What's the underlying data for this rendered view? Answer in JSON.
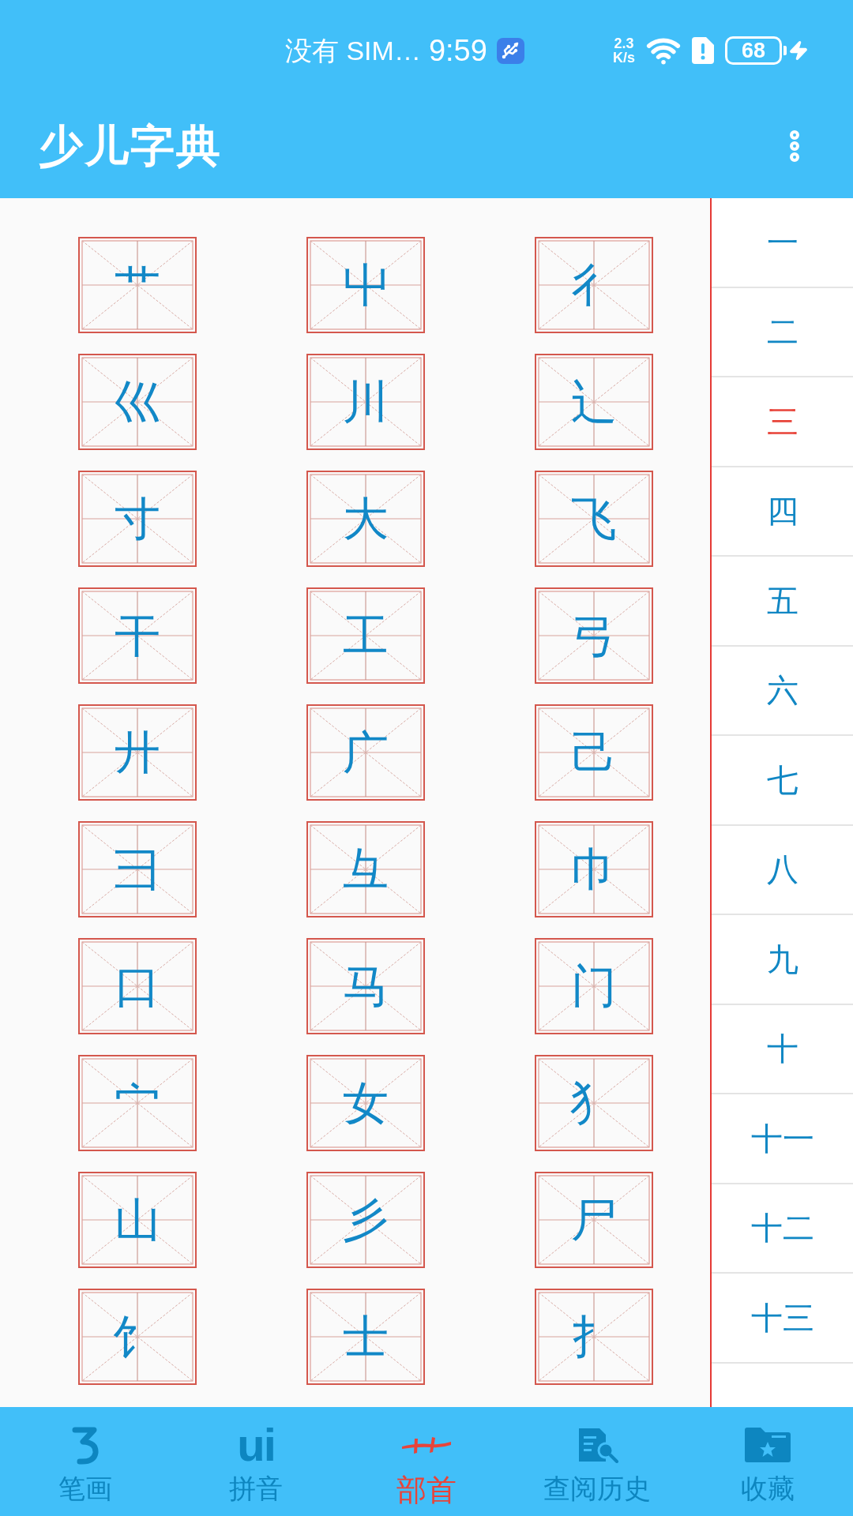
{
  "status_bar": {
    "carrier": "没有 SIM…",
    "time": "9:59",
    "speed_value": "2.3",
    "speed_unit": "K/s",
    "battery": "68",
    "charging": true
  },
  "app_bar": {
    "title": "少儿字典"
  },
  "radicals": [
    {
      "char": "艹"
    },
    {
      "char": "屮"
    },
    {
      "char": "彳"
    },
    {
      "char": "巛"
    },
    {
      "char": "川"
    },
    {
      "char": "辶"
    },
    {
      "char": "寸"
    },
    {
      "char": "大"
    },
    {
      "char": "飞"
    },
    {
      "char": "干"
    },
    {
      "char": "工"
    },
    {
      "char": "弓"
    },
    {
      "char": "廾"
    },
    {
      "char": "广"
    },
    {
      "char": "己"
    },
    {
      "char": "彐"
    },
    {
      "char": "彑"
    },
    {
      "char": "巾"
    },
    {
      "char": "口"
    },
    {
      "char": "马"
    },
    {
      "char": "门"
    },
    {
      "char": "宀"
    },
    {
      "char": "女"
    },
    {
      "char": "犭"
    },
    {
      "char": "山"
    },
    {
      "char": "彡"
    },
    {
      "char": "尸"
    },
    {
      "char": "饣"
    },
    {
      "char": "士"
    },
    {
      "char": "扌"
    }
  ],
  "stroke_counts": [
    {
      "label": "一",
      "selected": false
    },
    {
      "label": "二",
      "selected": false
    },
    {
      "label": "三",
      "selected": true
    },
    {
      "label": "四",
      "selected": false
    },
    {
      "label": "五",
      "selected": false
    },
    {
      "label": "六",
      "selected": false
    },
    {
      "label": "七",
      "selected": false
    },
    {
      "label": "八",
      "selected": false
    },
    {
      "label": "九",
      "selected": false
    },
    {
      "label": "十",
      "selected": false
    },
    {
      "label": "十一",
      "selected": false
    },
    {
      "label": "十二",
      "selected": false
    },
    {
      "label": "十三",
      "selected": false
    }
  ],
  "bottom_nav": [
    {
      "label": "笔画",
      "kind": "stroke",
      "selected": false
    },
    {
      "label": "拼音",
      "kind": "pinyin",
      "glyph": "ui",
      "selected": false
    },
    {
      "label": "部首",
      "kind": "radical",
      "selected": true
    },
    {
      "label": "查阅历史",
      "kind": "history",
      "selected": false
    },
    {
      "label": "收藏",
      "kind": "favorites",
      "selected": false
    }
  ]
}
